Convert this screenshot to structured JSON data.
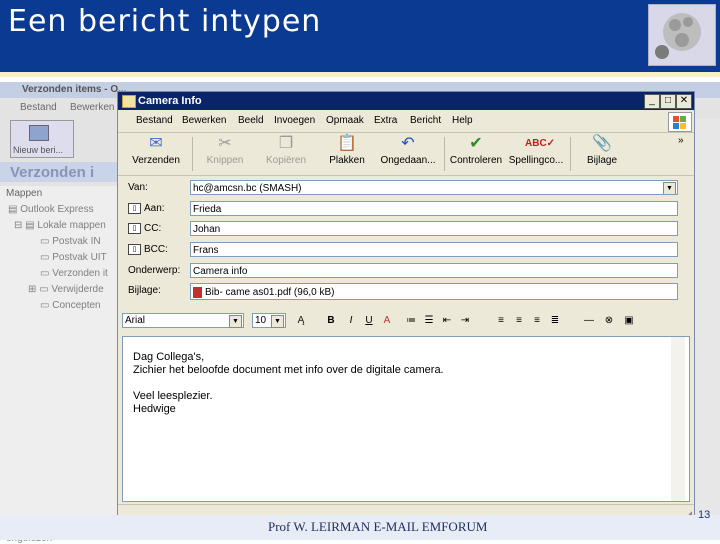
{
  "slide": {
    "title": "Een bericht intypen",
    "footer": "Prof W. LEIRMAN E-MAIL EMFORUM",
    "page_number": "13"
  },
  "background_app": {
    "window_title": "Verzonden items - O...",
    "menu": [
      "Bestand",
      "Bewerken"
    ],
    "new_message_label": "Nieuw beri...",
    "folder_bar_title": "Verzonden i",
    "folders_header": "Mappen",
    "tree": [
      "Outlook Express",
      "Lokale mappen",
      "Postvak IN",
      "Postvak UIT",
      "Verzonden it",
      "Verwijderde",
      "Concepten"
    ],
    "status_text": "7 bericht(en), 0 ongelezen"
  },
  "compose": {
    "window_title": "Camera Info",
    "menu": [
      "Bestand",
      "Bewerken",
      "Beeld",
      "Invoegen",
      "Opmaak",
      "Extra",
      "Bericht",
      "Help"
    ],
    "toolbar": [
      {
        "label": "Verzenden",
        "icon": "send-icon"
      },
      {
        "label": "Knippen",
        "icon": "scissors-icon"
      },
      {
        "label": "Kopiëren",
        "icon": "copy-icon"
      },
      {
        "label": "Plakken",
        "icon": "paste-icon"
      },
      {
        "label": "Ongedaan...",
        "icon": "undo-icon"
      },
      {
        "label": "Controleren",
        "icon": "check-names-icon"
      },
      {
        "label": "Spellingco...",
        "icon": "spelling-icon"
      },
      {
        "label": "Bijlage",
        "icon": "paperclip-icon"
      }
    ],
    "fields": {
      "from_label": "Van:",
      "from_value": "hc@amcsn.bc    (SMASH)",
      "to_label": "Aan:",
      "to_value": "Frieda",
      "cc_label": "CC:",
      "cc_value": "Johan",
      "bcc_label": "BCC:",
      "bcc_value": "Frans",
      "subject_label": "Onderwerp:",
      "subject_value": "Camera info",
      "attach_label": "Bijlage:",
      "attach_value": "Bib- came as01.pdf (96,0 kB)"
    },
    "format": {
      "font": "Arial",
      "size": "10"
    },
    "body_lines": [
      "Dag Collega's,",
      "Zichier het beloofde document met info over de digitale camera.",
      "",
      "Veel leesplezier.",
      "Hedwige"
    ]
  },
  "colors": {
    "slide_header": "#0b3a93",
    "window_title_bar": "#0a246a",
    "window_face": "#ece9d8"
  }
}
